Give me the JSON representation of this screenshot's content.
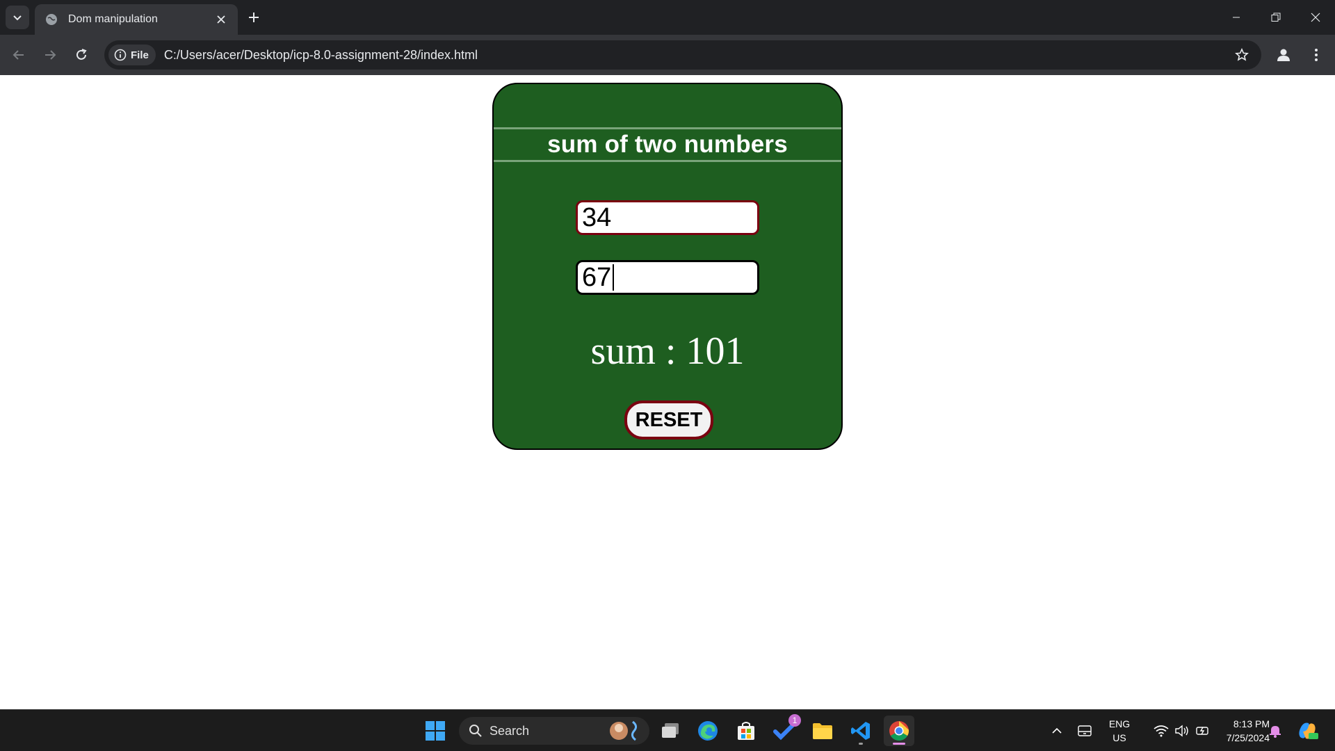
{
  "browser": {
    "tab_title": "Dom manipulation",
    "site_chip_label": "File",
    "url": "C:/Users/acer/Desktop/icp-8.0-assignment-28/index.html"
  },
  "page": {
    "title": "sum of two numbers",
    "input1_value": "34",
    "input2_value": "67",
    "sum_text": "sum : 101",
    "reset_label": "RESET"
  },
  "taskbar": {
    "search_label": "Search",
    "todo_badge": "1",
    "language_line1": "ENG",
    "language_line2": "US",
    "time": "8:13 PM",
    "date": "7/25/2024"
  },
  "colors": {
    "card_green": "#1e5e20",
    "input_border": "#7a0010",
    "chrome_dark": "#202124",
    "chrome_toolbar": "#35363a"
  },
  "icons": {
    "tab_search": "chevron-down-icon",
    "favicon": "globe-icon",
    "tab_close": "close-icon",
    "new_tab": "plus-icon",
    "back": "arrow-left-icon",
    "forward": "arrow-right-icon",
    "reload": "reload-icon",
    "info": "info-icon",
    "bookmark": "star-icon",
    "profile": "profile-icon",
    "menu": "kebab-menu-icon"
  }
}
